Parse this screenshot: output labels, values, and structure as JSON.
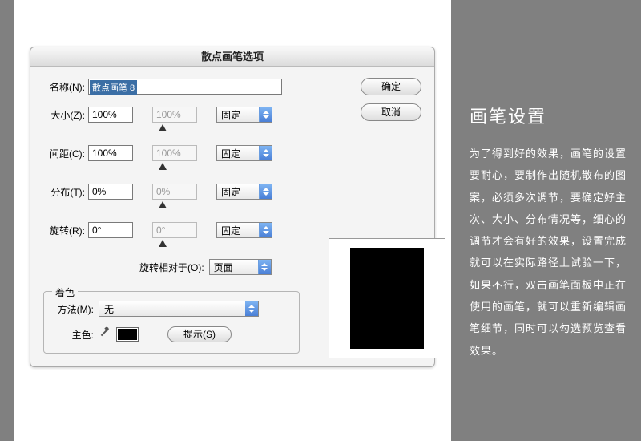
{
  "dialog": {
    "title": "散点画笔选项",
    "name_label": "名称(N):",
    "name_value": "散点画笔 8",
    "ok": "确定",
    "cancel": "取消",
    "params": [
      {
        "label": "大小(Z):",
        "val1": "100%",
        "val2": "100%",
        "mode": "固定"
      },
      {
        "label": "间距(C):",
        "val1": "100%",
        "val2": "100%",
        "mode": "固定"
      },
      {
        "label": "分布(T):",
        "val1": "0%",
        "val2": "0%",
        "mode": "固定"
      },
      {
        "label": "旋转(R):",
        "val1": "0°",
        "val2": "0°",
        "mode": "固定"
      }
    ],
    "relative_label": "旋转相对于(O):",
    "relative_value": "页面",
    "tint_legend": "着色",
    "method_label": "方法(M):",
    "method_value": "无",
    "keycolor_label": "主色:",
    "hint_label": "提示(S)"
  },
  "side": {
    "heading": "画笔设置",
    "body": "为了得到好的效果，画笔的设置要耐心，要制作出随机散布的图案，必须多次调节，要确定好主次、大小、分布情况等，细心的调节才会有好的效果，设置完成就可以在实际路径上试验一下，如果不行，双击画笔面板中正在使用的画笔，就可以重新编辑画笔细节，同时可以勾选预览查看效果。"
  }
}
